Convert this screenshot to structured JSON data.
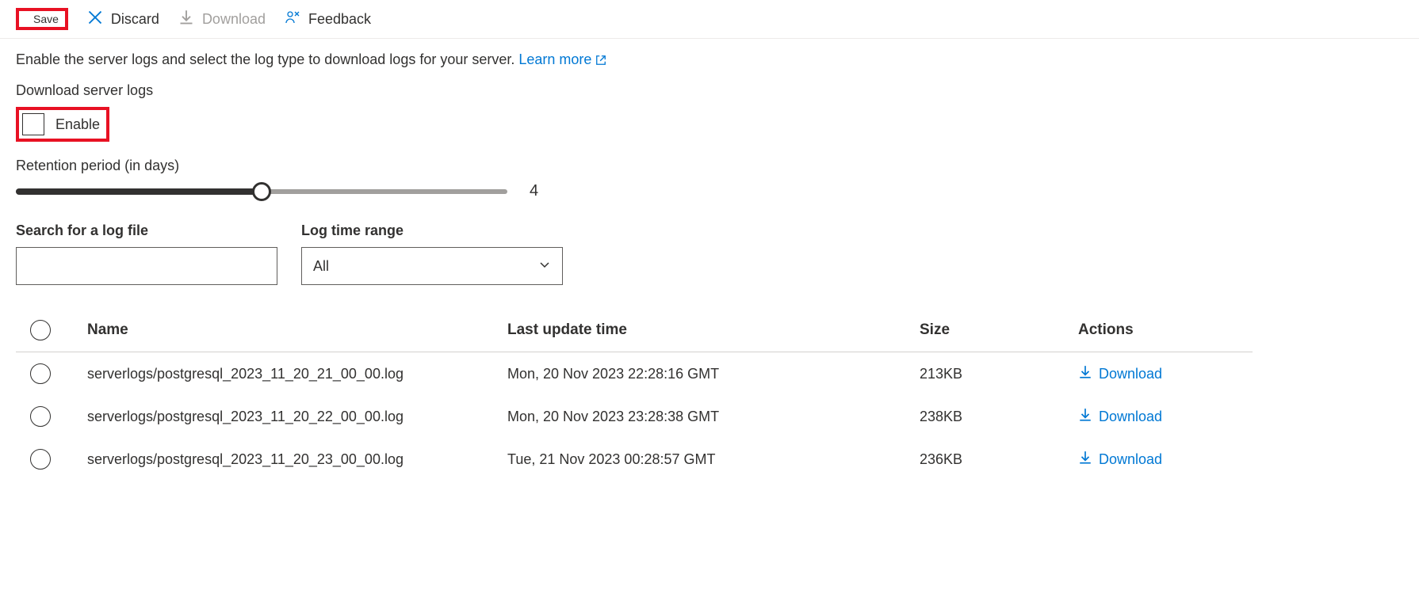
{
  "toolbar": {
    "save_label": "Save",
    "discard_label": "Discard",
    "download_label": "Download",
    "feedback_label": "Feedback"
  },
  "intro_text": "Enable the server logs and select the log type to download logs for your server.",
  "learn_more_label": "Learn more",
  "download_section_label": "Download server logs",
  "enable_label": "Enable",
  "retention_label": "Retention period (in days)",
  "retention_value": "4",
  "slider_percent": 50,
  "search_label": "Search for a log file",
  "search_value": "",
  "timerange_label": "Log time range",
  "timerange_value": "All",
  "table": {
    "headers": {
      "name": "Name",
      "last_update": "Last update time",
      "size": "Size",
      "actions": "Actions"
    },
    "rows": [
      {
        "name": "serverlogs/postgresql_2023_11_20_21_00_00.log",
        "updated": "Mon, 20 Nov 2023 22:28:16 GMT",
        "size": "213KB",
        "action": "Download"
      },
      {
        "name": "serverlogs/postgresql_2023_11_20_22_00_00.log",
        "updated": "Mon, 20 Nov 2023 23:28:38 GMT",
        "size": "238KB",
        "action": "Download"
      },
      {
        "name": "serverlogs/postgresql_2023_11_20_23_00_00.log",
        "updated": "Tue, 21 Nov 2023 00:28:57 GMT",
        "size": "236KB",
        "action": "Download"
      }
    ]
  }
}
